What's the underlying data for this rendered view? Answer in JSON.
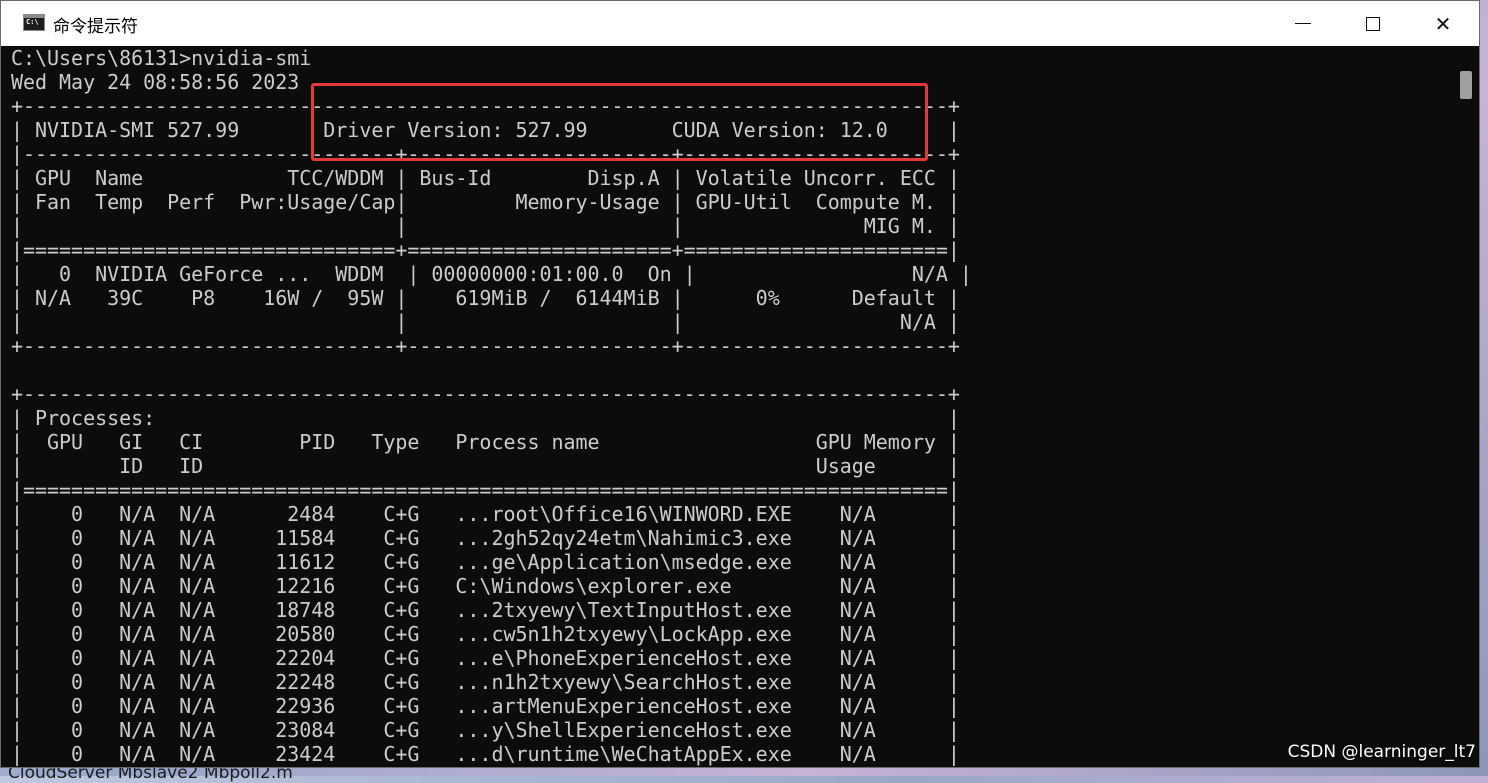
{
  "window": {
    "title": "命令提示符",
    "icon": "cmd-icon",
    "icon_label": "C:\\",
    "minimize_icon": "minimize-icon",
    "maximize_icon": "maximize-icon",
    "close_glyph": "✕"
  },
  "terminal": {
    "lines": [
      "C:\\Users\\86131>nvidia-smi",
      "Wed May 24 08:58:56 2023",
      "+-----------------------------------------------------------------------------+",
      "| NVIDIA-SMI 527.99       Driver Version: 527.99       CUDA Version: 12.0     |",
      "|-------------------------------+----------------------+----------------------+",
      "| GPU  Name            TCC/WDDM | Bus-Id        Disp.A | Volatile Uncorr. ECC |",
      "| Fan  Temp  Perf  Pwr:Usage/Cap|         Memory-Usage | GPU-Util  Compute M. |",
      "|                               |                      |               MIG M. |",
      "|===============================+======================+======================|",
      "|   0  NVIDIA GeForce ...  WDDM  | 00000000:01:00.0  On |                  N/A |",
      "| N/A   39C    P8    16W /  95W |    619MiB /  6144MiB |      0%      Default |",
      "|                               |                      |                  N/A |",
      "+-------------------------------+----------------------+----------------------+",
      "",
      "+-----------------------------------------------------------------------------+",
      "| Processes:                                                                  |",
      "|  GPU   GI   CI        PID   Type   Process name                  GPU Memory |",
      "|        ID   ID                                                   Usage      |",
      "|=============================================================================|",
      "|    0   N/A  N/A      2484    C+G   ...root\\Office16\\WINWORD.EXE    N/A      |",
      "|    0   N/A  N/A     11584    C+G   ...2gh52qy24etm\\Nahimic3.exe    N/A      |",
      "|    0   N/A  N/A     11612    C+G   ...ge\\Application\\msedge.exe    N/A      |",
      "|    0   N/A  N/A     12216    C+G   C:\\Windows\\explorer.exe         N/A      |",
      "|    0   N/A  N/A     18748    C+G   ...2txyewy\\TextInputHost.exe    N/A      |",
      "|    0   N/A  N/A     20580    C+G   ...cw5n1h2txyewy\\LockApp.exe    N/A      |",
      "|    0   N/A  N/A     22204    C+G   ...e\\PhoneExperienceHost.exe    N/A      |",
      "|    0   N/A  N/A     22248    C+G   ...n1h2txyewy\\SearchHost.exe    N/A      |",
      "|    0   N/A  N/A     22936    C+G   ...artMenuExperienceHost.exe    N/A      |",
      "|    0   N/A  N/A     23084    C+G   ...y\\ShellExperienceHost.exe    N/A      |",
      "|    0   N/A  N/A     23424    C+G   ...d\\runtime\\WeChatAppEx.exe    N/A      |"
    ]
  },
  "annotation": {
    "highlight_color": "#e53935",
    "highlight_target": "Driver Version: 527.99       CUDA Version: 12.0"
  },
  "watermark": "CSDN @learninger_lt7",
  "background_text": "CloudServer   Mbslave2      Mbpoll2.m",
  "colors": {
    "terminal_bg": "#0c0c0c",
    "terminal_fg": "#cccccc",
    "titlebar_bg": "#ffffff"
  }
}
